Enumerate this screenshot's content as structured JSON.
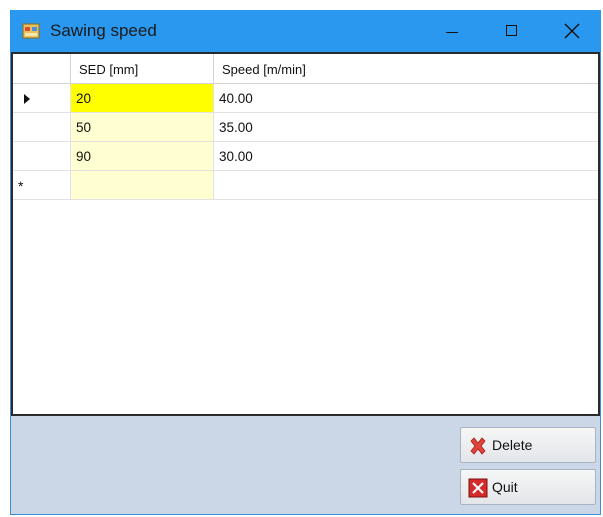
{
  "window": {
    "title": "Sawing speed",
    "icon": "app-icon",
    "controls": [
      "minimize-icon",
      "maximize-icon",
      "close-icon"
    ]
  },
  "grid": {
    "columns": [
      "SED [mm]",
      "Speed [m/min]"
    ],
    "rows": [
      {
        "sed": "20",
        "speed": "40.00",
        "current": true
      },
      {
        "sed": "50",
        "speed": "35.00",
        "current": false
      },
      {
        "sed": "90",
        "speed": "30.00",
        "current": false
      }
    ],
    "new_row_marker": "*"
  },
  "buttons": {
    "delete_label": "Delete",
    "quit_label": "Quit"
  },
  "colors": {
    "titlebar": "#2b98ef",
    "selected_cell": "#ffff00",
    "sed_column": "#ffffd1",
    "form_background": "#cbd7e7"
  }
}
